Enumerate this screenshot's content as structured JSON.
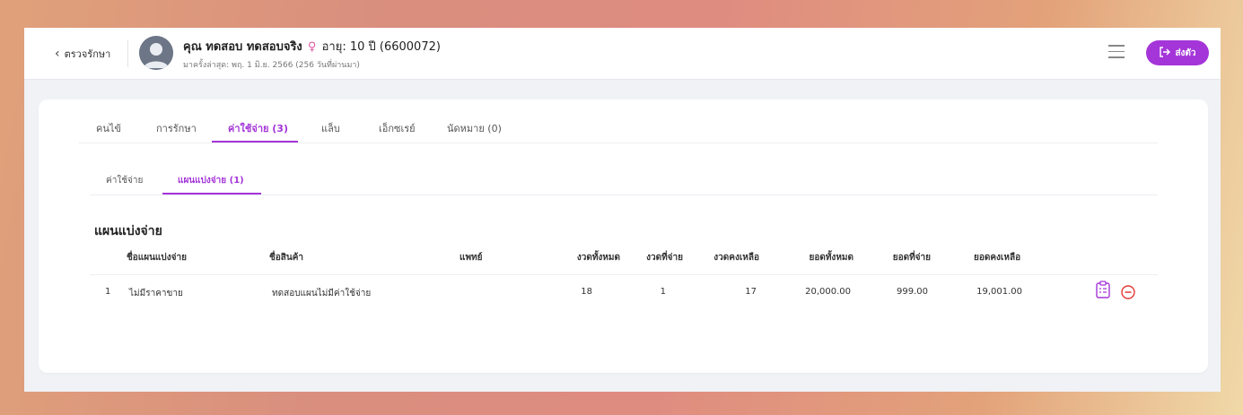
{
  "header": {
    "back_label": "ตรวจรักษา",
    "patient_name": "คุณ ทดสอบ ทดสอบจริง",
    "sex_symbol": "♀",
    "age_text": "อายุ: 10 ปี (6600072)",
    "last_visit": "มาครั้งล่าสุด: พฤ. 1 มิ.ย. 2566 (256 วันที่ผ่านมา)",
    "send_button_label": "ส่งตัว"
  },
  "tabs": [
    {
      "label": "คนไข้"
    },
    {
      "label": "การรักษา"
    },
    {
      "label": "ค่าใช้จ่าย (3)",
      "active": true
    },
    {
      "label": "แล็บ"
    },
    {
      "label": "เอ็กซเรย์"
    },
    {
      "label": "นัดหมาย (0)"
    }
  ],
  "subtabs": [
    {
      "label": "ค่าใช้จ่าย"
    },
    {
      "label": "แผนแบ่งจ่าย (1)",
      "active": true
    }
  ],
  "section_title": "แผนแบ่งจ่าย",
  "table": {
    "columns": [
      "ชื่อแผนแบ่งจ่าย",
      "ชื่อสินค้า",
      "แพทย์",
      "งวดทั้งหมด",
      "งวดที่จ่าย",
      "งวดคงเหลือ",
      "ยอดทั้งหมด",
      "ยอดที่จ่าย",
      "ยอดคงเหลือ"
    ],
    "rows": [
      {
        "index": "1",
        "plan_name": "ไม่มีราคาขาย",
        "product": "ทดสอบแผนไม่มีค่าใช้จ่าย",
        "doctor": "",
        "total_installments": "18",
        "paid_installments": "1",
        "remaining_installments": "17",
        "total_amount": "20,000.00",
        "paid_amount": "999.00",
        "remaining_amount": "19,001.00"
      }
    ]
  },
  "colors": {
    "accent": "#a435d8",
    "remove": "#e53935",
    "female": "#e05aa8"
  },
  "icons": {
    "back": "chevron-left-icon",
    "avatar": "user-avatar-icon",
    "menu": "hamburger-menu-icon",
    "send": "arrow-right-bracket-icon",
    "detail": "clipboard-list-icon",
    "remove": "minus-circle-icon"
  }
}
